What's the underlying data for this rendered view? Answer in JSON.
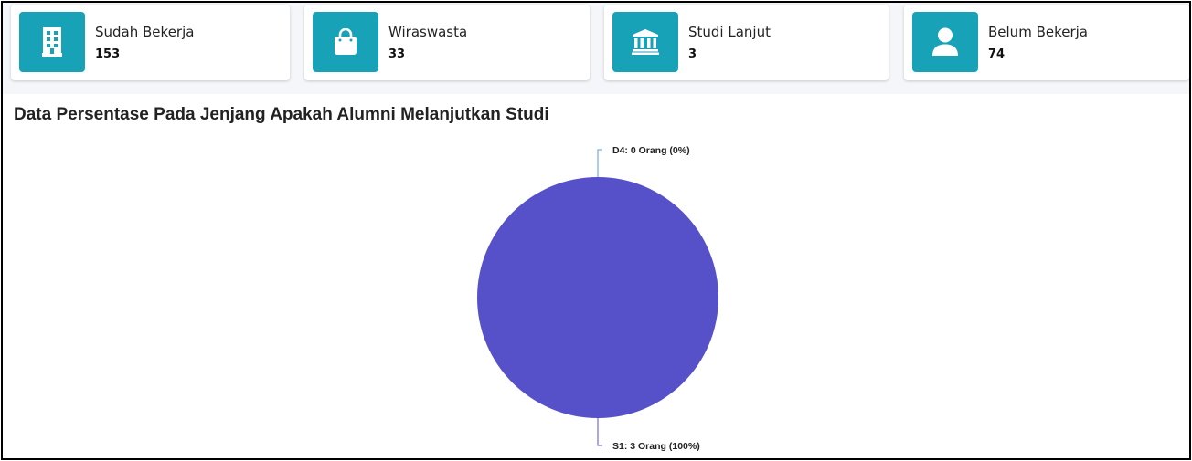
{
  "cards": [
    {
      "label": "Sudah Bekerja",
      "value": "153",
      "icon": "building-icon"
    },
    {
      "label": "Wiraswasta",
      "value": "33",
      "icon": "shopping-bag-icon"
    },
    {
      "label": "Studi Lanjut",
      "value": "3",
      "icon": "university-icon"
    },
    {
      "label": "Belum Bekerja",
      "value": "74",
      "icon": "user-icon"
    }
  ],
  "colors": {
    "card_icon_bg": "#17a2b8",
    "pie_fill": "#5651c8",
    "leader_line": "#5b9bd5"
  },
  "chart_data": {
    "type": "pie",
    "title": "Data Persentase Pada Jenjang Apakah Alumni Melanjutkan Studi",
    "slices": [
      {
        "name": "D4",
        "value": 0,
        "label": "D4: 0 Orang (0%)"
      },
      {
        "name": "S1",
        "value": 3,
        "label": "S1: 3 Orang (100%)"
      }
    ]
  }
}
